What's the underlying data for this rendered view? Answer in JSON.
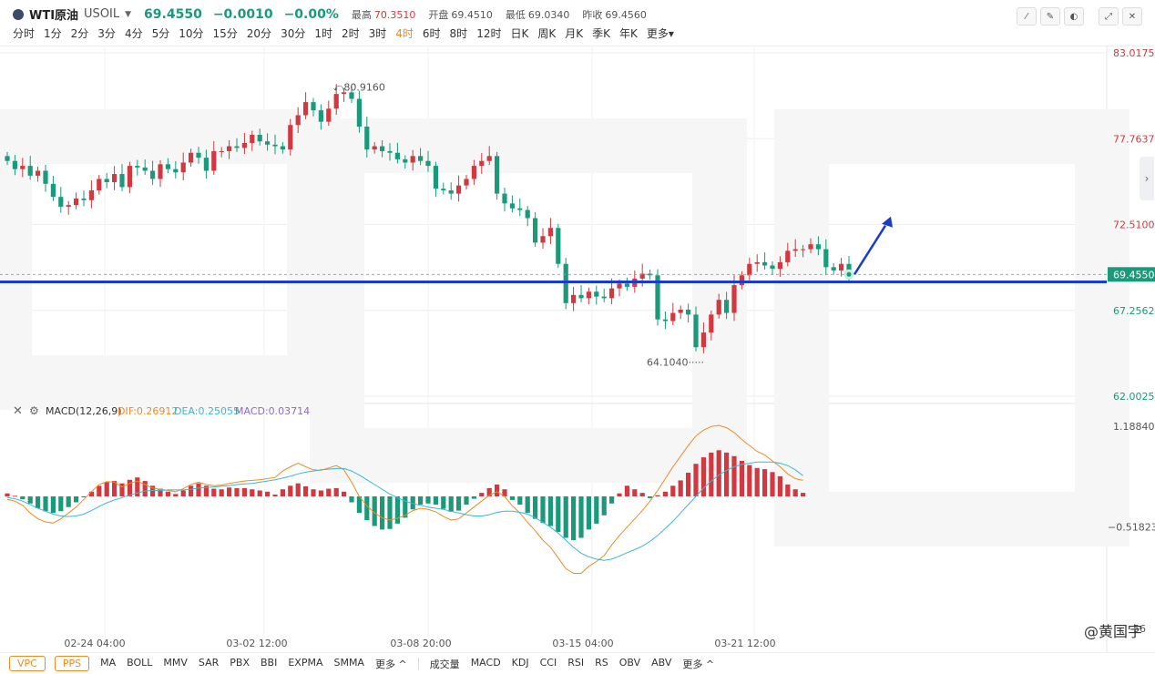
{
  "header": {
    "name": "WTI原油",
    "code": "USOIL",
    "price": "69.4550",
    "change": "−0.0010",
    "change_pct": "−0.00%",
    "high_label": "最高",
    "high": "70.3510",
    "open_label": "开盘",
    "open": "69.4510",
    "low_label": "最低",
    "low": "69.0340",
    "prev_label": "昨收",
    "prev": "69.4560"
  },
  "timeframes": [
    "分时",
    "1分",
    "2分",
    "3分",
    "4分",
    "5分",
    "10分",
    "15分",
    "20分",
    "30分",
    "1时",
    "2时",
    "3时",
    "4时",
    "6时",
    "8时",
    "12时",
    "日K",
    "周K",
    "月K",
    "季K",
    "年K",
    "更多"
  ],
  "active_timeframe": "4时",
  "toolbar_icons": [
    "trendline-icon",
    "pen-icon",
    "paint-icon",
    "expand-icon",
    "close-icon"
  ],
  "macd": {
    "label": "MACD(12,26,9)",
    "dif": "DIF:0.26912",
    "dea": "DEA:0.25055",
    "macd": "MACD:0.03714"
  },
  "colors": {
    "up": "#d0393f",
    "down": "#1a9a7a",
    "dif": "#f08a24",
    "dea": "#3bb7d6",
    "support": "#1a3bd0",
    "active": "#f08a24"
  },
  "bottom": {
    "tags": [
      "VPC",
      "PPS"
    ],
    "main_indicators": [
      "MA",
      "BOLL",
      "MMV",
      "SAR",
      "PBX",
      "BBI",
      "EXPMA",
      "SMMA",
      "更多 ^"
    ],
    "sub_indicators": [
      "成交量",
      "MACD",
      "KDJ",
      "CCI",
      "RSI",
      "RS",
      "OBV",
      "ABV",
      "更多 ^"
    ]
  },
  "watermark": "@黄国宇",
  "chart_data": {
    "type": "candlestick",
    "price_axis": [
      "83.0175",
      "77.7637",
      "72.5100",
      "67.2562",
      "62.0025"
    ],
    "last_price_label": "69.4550",
    "max_label": "80.9160",
    "min_label": "64.1040",
    "ylim": [
      62.0025,
      83.0175
    ],
    "macd_axis": [
      "1.18840",
      "−0.51823"
    ],
    "macd_axis_cut": "56",
    "x_ticks": [
      "02-24 04:00",
      "03-02 12:00",
      "03-08 20:00",
      "03-15 04:00",
      "03-21 12:00"
    ],
    "support_level": 69.0,
    "projection_target": 73.0,
    "closes": [
      76.4,
      75.9,
      76.1,
      75.5,
      75.8,
      75.0,
      74.2,
      73.6,
      73.7,
      74.1,
      74.0,
      74.6,
      75.3,
      75.1,
      75.6,
      74.8,
      76.1,
      76.0,
      75.8,
      75.3,
      76.2,
      75.9,
      75.7,
      76.3,
      76.9,
      76.6,
      75.8,
      77.0,
      77.0,
      77.3,
      77.2,
      77.5,
      78.0,
      77.6,
      77.4,
      77.3,
      77.1,
      78.6,
      79.2,
      80.0,
      79.5,
      78.8,
      79.6,
      80.5,
      80.6,
      80.2,
      78.5,
      77.1,
      77.3,
      77.0,
      76.9,
      76.5,
      76.3,
      76.7,
      76.4,
      76.1,
      74.7,
      74.6,
      74.4,
      74.9,
      75.3,
      76.1,
      76.4,
      76.7,
      74.4,
      73.8,
      73.5,
      73.4,
      72.9,
      71.4,
      71.8,
      72.3,
      70.1,
      67.7,
      68.2,
      68.0,
      68.4,
      68.1,
      68.0,
      68.6,
      68.9,
      68.7,
      69.2,
      69.5,
      69.4,
      66.7,
      66.6,
      67.1,
      67.3,
      67.0,
      65.0,
      65.9,
      67.0,
      67.9,
      67.1,
      68.8,
      69.4,
      70.1,
      70.2,
      70.0,
      69.8,
      70.2,
      70.9,
      71.0,
      71.0,
      71.3,
      71.0,
      69.9,
      69.7,
      70.1,
      69.5
    ],
    "hist": [
      0.05,
      0.01,
      -0.05,
      -0.12,
      -0.2,
      -0.25,
      -0.28,
      -0.25,
      -0.18,
      -0.1,
      0.0,
      0.08,
      0.18,
      0.24,
      0.26,
      0.22,
      0.28,
      0.32,
      0.26,
      0.18,
      0.13,
      0.08,
      0.04,
      0.1,
      0.18,
      0.22,
      0.18,
      0.13,
      0.12,
      0.15,
      0.14,
      0.14,
      0.12,
      0.1,
      0.08,
      0.03,
      0.12,
      0.18,
      0.22,
      0.17,
      0.12,
      0.1,
      0.13,
      0.14,
      0.08,
      -0.1,
      -0.28,
      -0.4,
      -0.5,
      -0.56,
      -0.55,
      -0.46,
      -0.36,
      -0.22,
      -0.14,
      -0.12,
      -0.14,
      -0.21,
      -0.26,
      -0.24,
      -0.14,
      -0.04,
      0.06,
      0.14,
      0.2,
      0.12,
      -0.06,
      -0.14,
      -0.28,
      -0.38,
      -0.45,
      -0.5,
      -0.6,
      -0.7,
      -0.74,
      -0.7,
      -0.56,
      -0.46,
      -0.32,
      -0.12,
      0.05,
      0.18,
      0.12,
      0.06,
      -0.03,
      0.02,
      0.08,
      0.18,
      0.27,
      0.4,
      0.55,
      0.66,
      0.74,
      0.78,
      0.74,
      0.68,
      0.6,
      0.53,
      0.48,
      0.46,
      0.41,
      0.34,
      0.2,
      0.12,
      0.06
    ],
    "dif": [
      -0.05,
      -0.08,
      -0.15,
      -0.28,
      -0.38,
      -0.43,
      -0.45,
      -0.38,
      -0.28,
      -0.18,
      -0.05,
      0.08,
      0.2,
      0.25,
      0.24,
      0.16,
      0.22,
      0.26,
      0.2,
      0.14,
      0.12,
      0.1,
      0.08,
      0.13,
      0.2,
      0.24,
      0.2,
      0.18,
      0.19,
      0.22,
      0.24,
      0.26,
      0.27,
      0.28,
      0.3,
      0.32,
      0.43,
      0.5,
      0.56,
      0.5,
      0.45,
      0.44,
      0.48,
      0.52,
      0.45,
      0.24,
      0.0,
      -0.16,
      -0.28,
      -0.36,
      -0.4,
      -0.37,
      -0.32,
      -0.24,
      -0.2,
      -0.22,
      -0.26,
      -0.34,
      -0.4,
      -0.38,
      -0.28,
      -0.18,
      -0.08,
      0.02,
      0.08,
      0.0,
      -0.16,
      -0.28,
      -0.44,
      -0.58,
      -0.74,
      -0.86,
      -1.04,
      -1.22,
      -1.3,
      -1.3,
      -1.18,
      -1.1,
      -1.0,
      -0.82,
      -0.66,
      -0.52,
      -0.38,
      -0.24,
      -0.08,
      0.1,
      0.3,
      0.5,
      0.68,
      0.86,
      1.02,
      1.12,
      1.18,
      1.2,
      1.16,
      1.08,
      0.96,
      0.86,
      0.76,
      0.7,
      0.6,
      0.5,
      0.38,
      0.3,
      0.27
    ],
    "dea": [
      -0.02,
      -0.04,
      -0.08,
      -0.14,
      -0.2,
      -0.25,
      -0.3,
      -0.33,
      -0.34,
      -0.33,
      -0.3,
      -0.24,
      -0.17,
      -0.11,
      -0.06,
      -0.02,
      0.02,
      0.06,
      0.09,
      0.1,
      0.1,
      0.11,
      0.11,
      0.11,
      0.12,
      0.14,
      0.15,
      0.16,
      0.17,
      0.18,
      0.2,
      0.21,
      0.22,
      0.24,
      0.26,
      0.28,
      0.31,
      0.34,
      0.38,
      0.41,
      0.43,
      0.45,
      0.46,
      0.47,
      0.47,
      0.43,
      0.36,
      0.28,
      0.2,
      0.12,
      0.04,
      -0.02,
      -0.08,
      -0.12,
      -0.15,
      -0.18,
      -0.2,
      -0.22,
      -0.25,
      -0.28,
      -0.31,
      -0.33,
      -0.33,
      -0.31,
      -0.27,
      -0.25,
      -0.25,
      -0.27,
      -0.3,
      -0.36,
      -0.44,
      -0.52,
      -0.62,
      -0.74,
      -0.86,
      -0.96,
      -1.02,
      -1.06,
      -1.08,
      -1.06,
      -1.01,
      -0.95,
      -0.9,
      -0.84,
      -0.76,
      -0.66,
      -0.54,
      -0.42,
      -0.28,
      -0.14,
      0.0,
      0.14,
      0.26,
      0.36,
      0.44,
      0.5,
      0.54,
      0.56,
      0.58,
      0.58,
      0.58,
      0.56,
      0.52,
      0.45,
      0.35
    ]
  }
}
